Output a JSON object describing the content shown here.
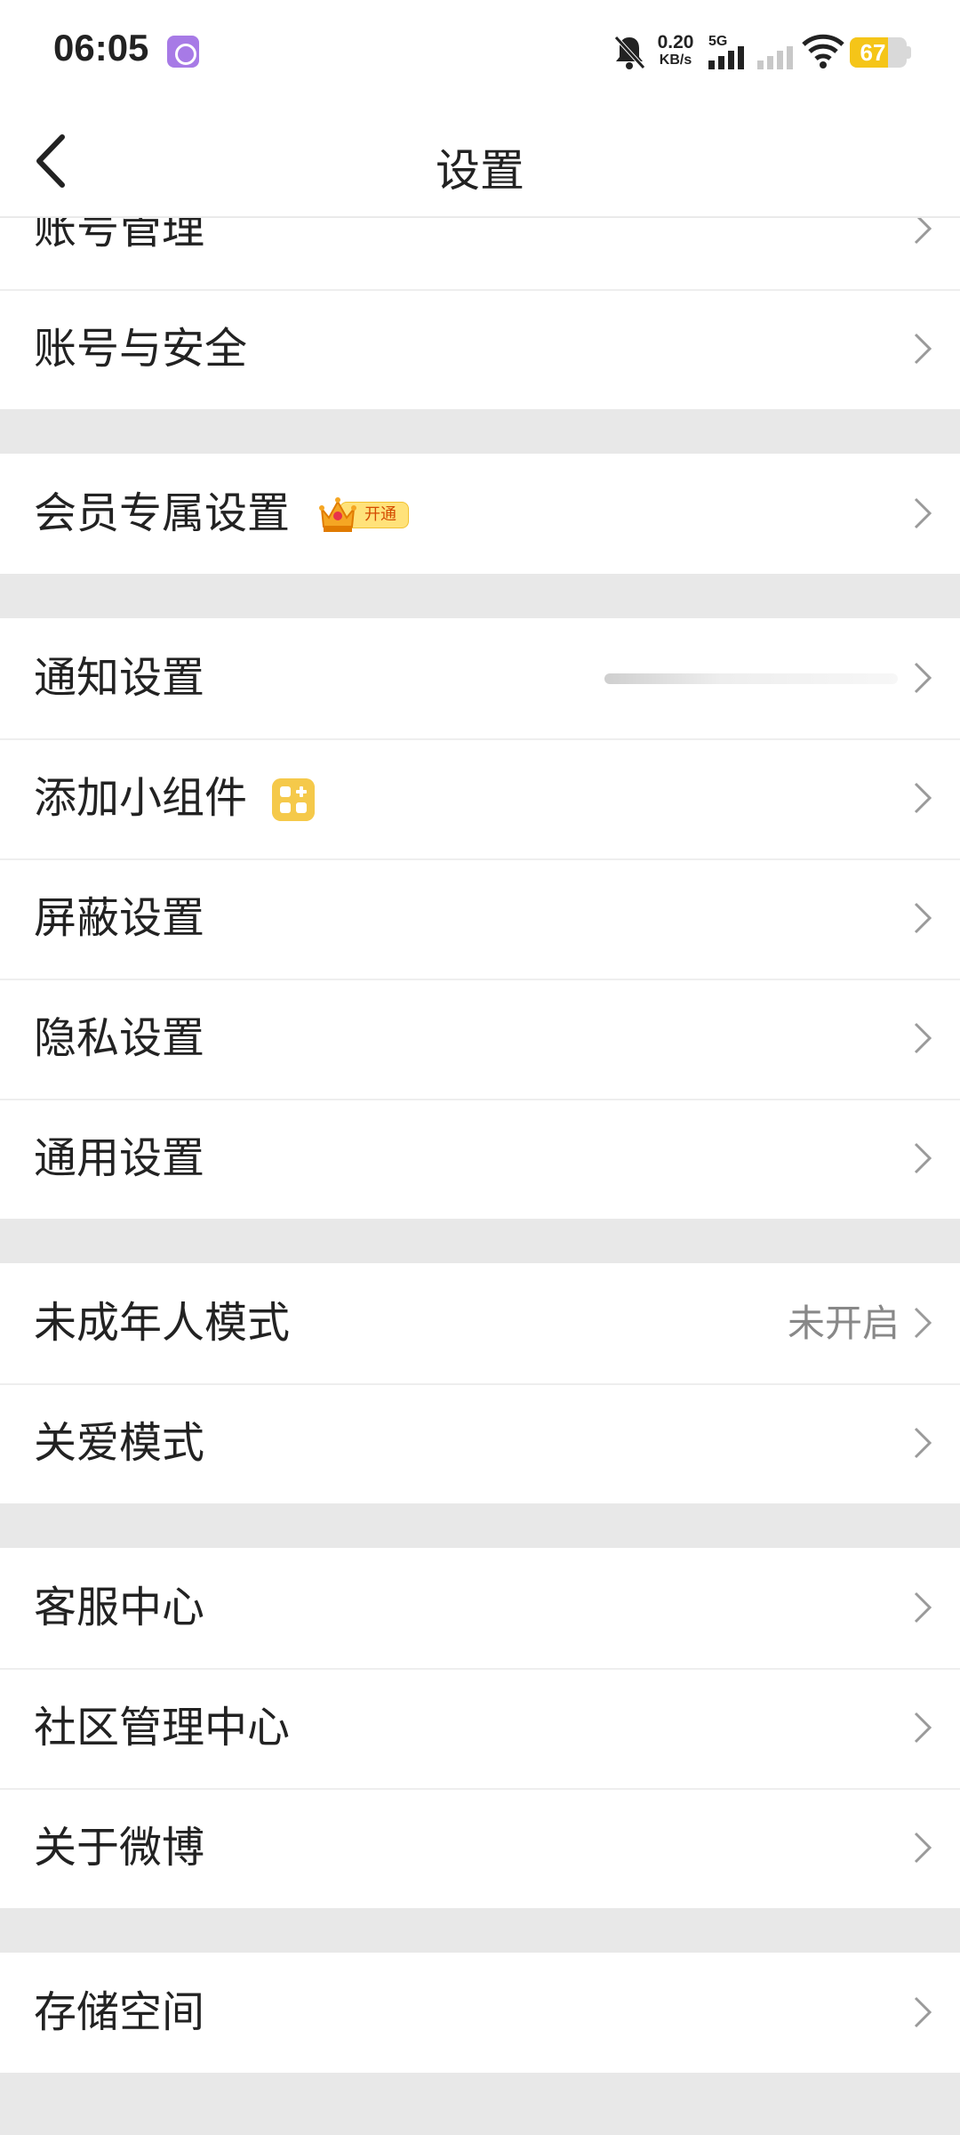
{
  "status_bar": {
    "time": "06:05",
    "net_speed_value": "0.20",
    "net_speed_unit": "KB/s",
    "signal_label": "5G",
    "battery_level": "67",
    "battery_fraction": 0.67,
    "battery_color": "#f5c518"
  },
  "header": {
    "title": "设置"
  },
  "groups": [
    {
      "rows": [
        {
          "label": "账号管理"
        },
        {
          "label": "账号与安全"
        }
      ]
    },
    {
      "rows": [
        {
          "label": "会员专属设置",
          "badge": "开通"
        }
      ]
    },
    {
      "rows": [
        {
          "label": "通知设置"
        },
        {
          "label": "添加小组件"
        },
        {
          "label": "屏蔽设置"
        },
        {
          "label": "隐私设置"
        },
        {
          "label": "通用设置"
        }
      ]
    },
    {
      "rows": [
        {
          "label": "未成年人模式",
          "value": "未开启"
        },
        {
          "label": "关爱模式"
        }
      ]
    },
    {
      "rows": [
        {
          "label": "客服中心"
        },
        {
          "label": "社区管理中心"
        },
        {
          "label": "关于微博"
        }
      ]
    },
    {
      "rows": [
        {
          "label": "存储空间"
        }
      ]
    }
  ]
}
